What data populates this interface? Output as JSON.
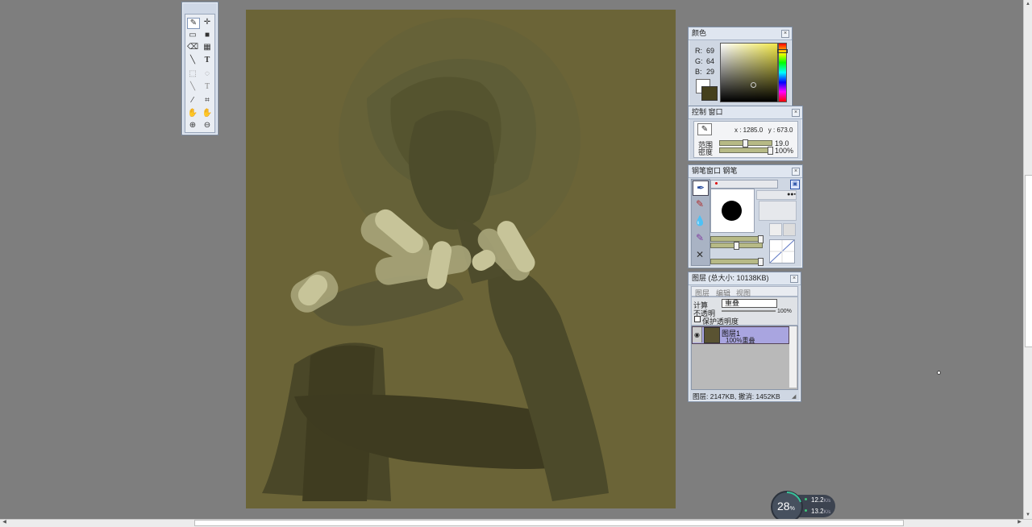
{
  "colors": {
    "desktop": "#7e7e7e",
    "canvas_bg": "#6b6437",
    "current_color": "#45401d"
  },
  "toolbox": {
    "tools": [
      "pencil-tool-icon",
      "move-tool-icon",
      "rect-select-tool-icon",
      "fill-rect-tool-icon",
      "eraser-tool-icon",
      "gradient-tool-icon",
      "line-tool-icon",
      "text-tool-icon",
      "marquee-tool-icon",
      "lasso-tool-icon",
      "straight-line-tool-icon",
      "vertical-text-tool-icon",
      "eyedropper-tool-icon",
      "crop-tool-icon",
      "hand-tool-icon",
      "rotate-hand-tool-icon",
      "zoom-in-tool-icon",
      "zoom-out-tool-icon"
    ]
  },
  "color_panel": {
    "title": "颜色",
    "r_label": "R:",
    "r": "69",
    "g_label": "G:",
    "g": "64",
    "b_label": "B:",
    "b": "29"
  },
  "control_panel": {
    "title": "控制 窗口",
    "coords": "x : 1285.0   y : 673.0",
    "range_label": "范围",
    "range_value": "19.0",
    "density_label": "密度",
    "density_value": "100%"
  },
  "brush_panel": {
    "title": "钢笔窗口  钢笔"
  },
  "layer_panel": {
    "title": "图层 (总大小: 10138KB)",
    "menu": [
      "图层",
      "编辑",
      "视图"
    ],
    "calc_label": "计算",
    "blend_mode": "重叠",
    "opacity_label": "不透明",
    "opacity_value": "100%",
    "protect_label": "保护透明度",
    "layer_name": "图层1",
    "layer_info": "100%重叠",
    "status": "图层: 2147KB, 撤消: 1452KB"
  },
  "net_widget": {
    "percent": "28",
    "percent_unit": "%",
    "upload": "12.2",
    "download": "13.2",
    "rate_unit": "K/s"
  }
}
